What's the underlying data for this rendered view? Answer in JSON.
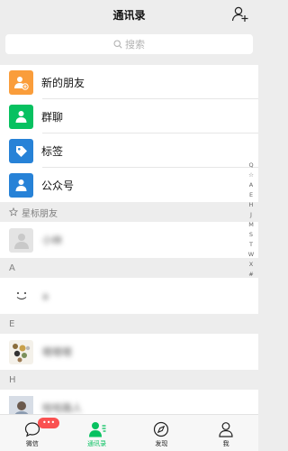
{
  "header": {
    "title": "通讯录"
  },
  "search": {
    "placeholder": "搜索"
  },
  "features": [
    {
      "label": "新的朋友",
      "color": "#fa9d3b",
      "icon": "new-friend-icon"
    },
    {
      "label": "群聊",
      "color": "#07c160",
      "icon": "group-chat-icon"
    },
    {
      "label": "标签",
      "color": "#2782d7",
      "icon": "tag-icon"
    },
    {
      "label": "公众号",
      "color": "#2782d7",
      "icon": "official-account-icon"
    }
  ],
  "sections": {
    "starred": "星标朋友",
    "a": "A",
    "e": "E",
    "h": "H"
  },
  "contacts": {
    "starred_1": "小林",
    "a_1": "a",
    "e_1": "嗯嗯嗯",
    "h_1": "哈哈路人"
  },
  "index_letters": [
    "Q",
    "☆",
    "A",
    "E",
    "H",
    "J",
    "M",
    "S",
    "T",
    "W",
    "X",
    "#"
  ],
  "tabs": [
    {
      "label": "微信",
      "badge": "•••"
    },
    {
      "label": "通讯录"
    },
    {
      "label": "发现"
    },
    {
      "label": "我"
    }
  ],
  "colors": {
    "accent": "#07c160",
    "badge": "#fa5151"
  }
}
